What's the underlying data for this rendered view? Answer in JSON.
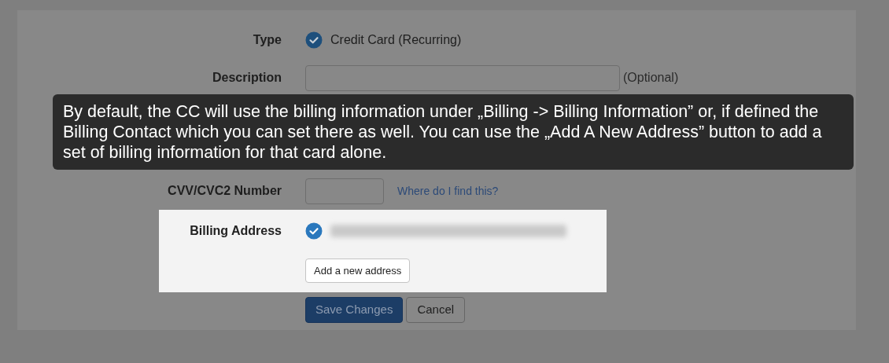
{
  "form": {
    "rows": [
      {
        "kind": "radio",
        "label": "Type",
        "option": "Credit Card (Recurring)",
        "checked": true
      },
      {
        "kind": "text",
        "label": "Description",
        "note": "(Optional)"
      },
      {
        "kind": "card"
      },
      {
        "kind": "cvv",
        "label": "CVV/CVC2 Number",
        "link": "Where do I find this?"
      }
    ]
  },
  "billing": {
    "label": "Billing Address",
    "checked": true,
    "button": "Add a new address"
  },
  "buttons": [
    {
      "kind": "primary",
      "label": "Save Changes"
    },
    {
      "kind": "secondary",
      "label": "Cancel"
    }
  ],
  "tooltip": {
    "text": "By default, the CC will use the billing information under „Billing -> Billing Information” or, if defined the Billing Contact which you can set there as well. You can use the „Add A New Address” button to add a set of billing information for that card alone."
  }
}
